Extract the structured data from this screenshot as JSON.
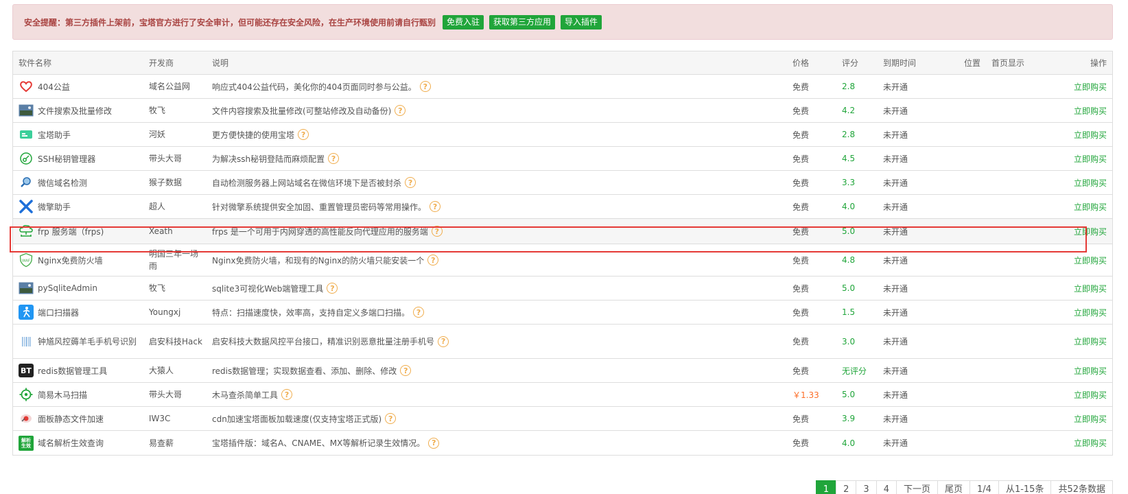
{
  "alert": {
    "text": "安全提醒：第三方插件上架前，宝塔官方进行了安全审计，但可能还存在安全风险，在生产环境使用前请自行甄别",
    "buttons": [
      "免费入驻",
      "获取第三方应用",
      "导入插件"
    ]
  },
  "table": {
    "headers": {
      "name": "软件名称",
      "dev": "开发商",
      "desc": "说明",
      "price": "价格",
      "score": "评分",
      "expire": "到期时间",
      "position": "位置",
      "homepage": "首页显示",
      "op": "操作"
    },
    "rows": [
      {
        "name": "404公益",
        "dev": "域名公益网",
        "desc": "响应式404公益代码，美化你的404页面同时参与公益。",
        "price": "免费",
        "score": "2.8",
        "expire": "未开通",
        "op": "立即购买",
        "icon": "heart-icon"
      },
      {
        "name": "文件搜索及批量修改",
        "dev": "牧飞",
        "desc": "文件内容搜索及批量修改(可整站修改及自动备份)",
        "price": "免费",
        "score": "4.2",
        "expire": "未开通",
        "op": "立即购买",
        "icon": "picture-icon"
      },
      {
        "name": "宝塔助手",
        "dev": "河妖",
        "desc": "更方便快捷的使用宝塔",
        "price": "免费",
        "score": "2.8",
        "expire": "未开通",
        "op": "立即购买",
        "icon": "assistant-icon"
      },
      {
        "name": "SSH秘钥管理器",
        "dev": "带头大哥",
        "desc": "为解决ssh秘钥登陆而麻烦配置",
        "price": "免费",
        "score": "4.5",
        "expire": "未开通",
        "op": "立即购买",
        "icon": "key-icon"
      },
      {
        "name": "微信域名检测",
        "dev": "猴子数据",
        "desc": "自动检测服务器上网站域名在微信环境下是否被封杀",
        "price": "免费",
        "score": "3.3",
        "expire": "未开通",
        "op": "立即购买",
        "icon": "search-icon"
      },
      {
        "name": "微擎助手",
        "dev": "超人",
        "desc": "针对微擎系统提供安全加固、重置管理员密码等常用操作。",
        "price": "免费",
        "score": "4.0",
        "expire": "未开通",
        "op": "立即购买",
        "icon": "tools-icon"
      },
      {
        "name": "frp 服务端（frps)",
        "dev": "Xeath",
        "desc": "frps 是一个可用于内网穿透的高性能反向代理应用的服务端",
        "price": "免费",
        "score": "5.0",
        "expire": "未开通",
        "op": "立即购买",
        "icon": "network-icon"
      },
      {
        "name": "Nginx免费防火墙",
        "dev": "明国三年一场雨",
        "desc": "Nginx免费防火墙，和现有的Nginx的防火墙只能安装一个",
        "price": "免费",
        "score": "4.8",
        "expire": "未开通",
        "op": "立即购买",
        "icon": "waf-shield-icon"
      },
      {
        "name": "pySqliteAdmin",
        "dev": "牧飞",
        "desc": "sqlite3可视化Web端管理工具",
        "price": "免费",
        "score": "5.0",
        "expire": "未开通",
        "op": "立即购买",
        "icon": "picture-icon"
      },
      {
        "name": "端口扫描器",
        "dev": "Youngxj",
        "desc": "特点：扫描速度快，效率高，支持自定义多端口扫描。",
        "price": "免费",
        "score": "1.5",
        "expire": "未开通",
        "op": "立即购买",
        "icon": "runner-icon"
      },
      {
        "name": "钟馗风控薅羊毛手机号识别",
        "dev": "启安科技Hack",
        "desc": "启安科技大数据风控平台接口，精准识别恶意批量注册手机号",
        "price": "免费",
        "score": "3.0",
        "expire": "未开通",
        "op": "立即购买",
        "icon": "barcode-icon"
      },
      {
        "name": "redis数据管理工具",
        "dev": "大猿人",
        "desc": "redis数据管理；实现数据查看、添加、删除、修改",
        "price": "免费",
        "score": "无评分",
        "expire": "未开通",
        "op": "立即购买",
        "icon": "bt-icon"
      },
      {
        "name": "简易木马扫描",
        "dev": "带头大哥",
        "desc": "木马查杀简单工具",
        "price": "￥1.33",
        "score": "5.0",
        "expire": "未开通",
        "op": "立即购买",
        "icon": "target-icon"
      },
      {
        "name": "面板静态文件加速",
        "dev": "IW3C",
        "desc": "cdn加速宝塔面板加载速度(仅支持宝塔正式版)",
        "price": "免费",
        "score": "3.9",
        "expire": "未开通",
        "op": "立即购买",
        "icon": "rocket-icon"
      },
      {
        "name": "域名解析生效查询",
        "dev": "易查薪",
        "desc": "宝塔插件版：域名A、CNAME、MX等解析记录生效情况。",
        "price": "免费",
        "score": "4.0",
        "expire": "未开通",
        "op": "立即购买",
        "icon": "dns-icon"
      }
    ]
  },
  "icon_text": {
    "bt": "BT",
    "waf": "WAF",
    "dns": "解析生效",
    "help": "?"
  },
  "pager": [
    "1",
    "2",
    "3",
    "4",
    "下一页",
    "尾页",
    "1/4",
    "从1-15条",
    "共52条数据"
  ],
  "colors": {
    "accent": "#20a53a",
    "alert_bg": "#f2dede",
    "alert_text": "#a94442",
    "help": "#f0ad4e",
    "highlight": "#e53935",
    "price_red": "#fc6d26"
  }
}
